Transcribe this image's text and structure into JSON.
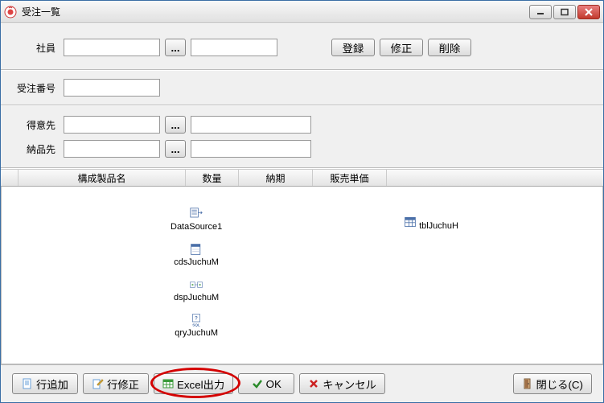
{
  "window": {
    "title": "受注一覧"
  },
  "section1": {
    "employee_label": "社員",
    "employee_code": "",
    "employee_name": "",
    "register_label": "登録",
    "edit_label": "修正",
    "delete_label": "削除",
    "ellipsis": "..."
  },
  "section2": {
    "orderno_label": "受注番号",
    "orderno_value": ""
  },
  "section3": {
    "customer_label": "得意先",
    "customer_code": "",
    "customer_name": "",
    "shipto_label": "納品先",
    "shipto_code": "",
    "shipto_name": "",
    "ellipsis": "..."
  },
  "grid": {
    "col1": "構成製品名",
    "col2": "数量",
    "col3": "納期",
    "col4": "販売単価"
  },
  "components": {
    "datasource": "DataSource1",
    "cds": "cdsJuchuM",
    "dsp": "dspJuchuM",
    "qry": "qryJuchuM",
    "tbl": "tblJuchuH",
    "sql_label": "SQL"
  },
  "footer": {
    "addrow": "行追加",
    "editrow": "行修正",
    "excel": "Excel出力",
    "ok": "OK",
    "cancel": "キャンセル",
    "close": "閉じる(C)"
  }
}
